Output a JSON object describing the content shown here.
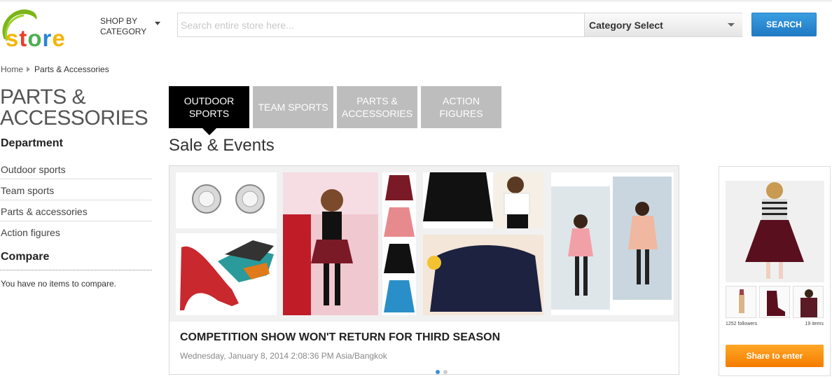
{
  "header": {
    "logo_text": "store",
    "shop_by_category": "SHOP BY CATEGORY",
    "search": {
      "placeholder": "Search entire store here...",
      "value": ""
    },
    "category_select": "Category Select",
    "search_button": "SEARCH"
  },
  "breadcrumb": {
    "home": "Home",
    "current": "Parts & Accessories"
  },
  "sidebar": {
    "page_title": "PARTS & ACCESSORIES",
    "department_heading": "Department",
    "departments": [
      {
        "label": "Outdoor sports"
      },
      {
        "label": "Team sports"
      },
      {
        "label": "Parts & accessories"
      },
      {
        "label": "Action figures"
      }
    ],
    "compare_heading": "Compare",
    "compare_text": "You have no items to compare."
  },
  "tabs": [
    {
      "label": "OUTDOOR SPORTS",
      "active": true
    },
    {
      "label": "TEAM SPORTS",
      "active": false
    },
    {
      "label": "PARTS & ACCESSORIES",
      "active": false
    },
    {
      "label": "ACTION FIGURES",
      "active": false
    }
  ],
  "section_title": "Sale & Events",
  "slide": {
    "caption": "COMPETITION SHOW WON'T RETURN FOR THIRD SEASON",
    "date": "Wednesday, January 8, 2014 2:08:36 PM Asia/Bangkok",
    "slide_count": 2,
    "active_slide": 1
  },
  "widget": {
    "followers": "1252 followers",
    "items": "19 items",
    "share_button": "Share to enter"
  },
  "colors": {
    "accent_blue": "#2a86d3",
    "tab_active": "#000000",
    "tab_inactive": "#bdbdbd",
    "share_orange": "#f7931e",
    "logo_swoosh": "#7cb518"
  }
}
